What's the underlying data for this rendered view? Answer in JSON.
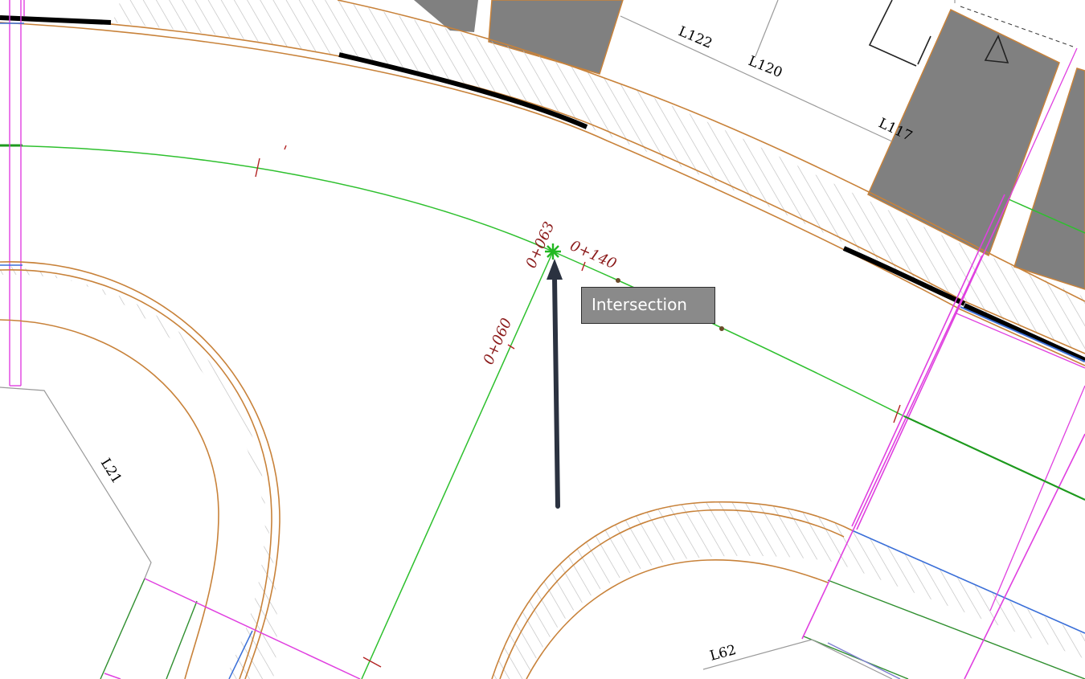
{
  "tooltip": {
    "text": "Intersection"
  },
  "stations": {
    "s060": "0+060",
    "s063": "0+063",
    "s140": "0+140"
  },
  "lines": {
    "l122": "L122",
    "l120": "L120",
    "l117": "L117",
    "l21": "L21",
    "l62": "L62"
  },
  "colors": {
    "alignment": "#2ec02e",
    "curb": "#c8823a",
    "parking": "#808080",
    "station_text": "#8b1a1a",
    "magenta": "#e040e0",
    "arrow": "#2b3240"
  },
  "icons": {
    "snap_marker": "intersection-snap-icon",
    "pointer": "arrow-icon"
  }
}
